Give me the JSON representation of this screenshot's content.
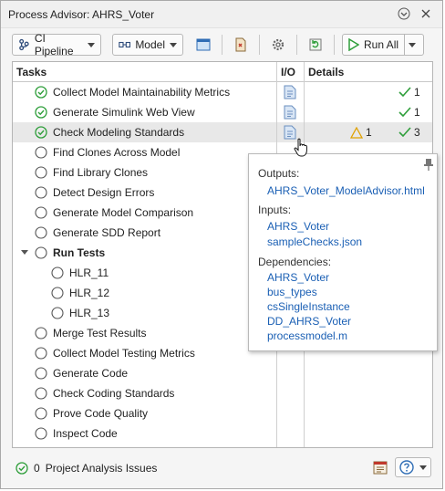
{
  "window": {
    "title": "Process Advisor: AHRS_Voter"
  },
  "toolbar": {
    "pipeline_label": "CI Pipeline",
    "model_label": "Model",
    "run_all_label": "Run All"
  },
  "table": {
    "headers": {
      "tasks": "Tasks",
      "io": "I/O",
      "details": "Details"
    },
    "rows": [
      {
        "label": "Collect Model Maintainability Metrics",
        "status": "done",
        "io": true,
        "pass": "1"
      },
      {
        "label": "Generate Simulink Web View",
        "status": "done",
        "io": true,
        "pass": "1"
      },
      {
        "label": "Check Modeling Standards",
        "status": "done",
        "io": true,
        "warn": "1",
        "pass": "3"
      },
      {
        "label": "Find Clones Across Model",
        "status": "pending"
      },
      {
        "label": "Find Library Clones",
        "status": "pending"
      },
      {
        "label": "Detect Design Errors",
        "status": "pending"
      },
      {
        "label": "Generate Model Comparison",
        "status": "pending"
      },
      {
        "label": "Generate SDD Report",
        "status": "pending"
      },
      {
        "label": "Run Tests",
        "status": "pending"
      },
      {
        "label": "HLR_11",
        "status": "pending"
      },
      {
        "label": "HLR_12",
        "status": "pending"
      },
      {
        "label": "HLR_13",
        "status": "pending"
      },
      {
        "label": "Merge Test Results",
        "status": "pending"
      },
      {
        "label": "Collect Model Testing Metrics",
        "status": "pending"
      },
      {
        "label": "Generate Code",
        "status": "pending"
      },
      {
        "label": "Check Coding Standards",
        "status": "pending"
      },
      {
        "label": "Prove Code Quality",
        "status": "pending"
      },
      {
        "label": "Inspect Code",
        "status": "pending"
      }
    ]
  },
  "tooltip": {
    "outputs_heading": "Outputs:",
    "outputs": [
      "AHRS_Voter_ModelAdvisor.html"
    ],
    "inputs_heading": "Inputs:",
    "inputs": [
      "AHRS_Voter",
      "sampleChecks.json"
    ],
    "dependencies_heading": "Dependencies:",
    "dependencies": [
      "AHRS_Voter",
      "bus_types",
      "csSingleInstance",
      "DD_AHRS_Voter",
      "processmodel.m"
    ]
  },
  "statusbar": {
    "issue_count": "0",
    "issue_label": "Project Analysis Issues"
  },
  "colors": {
    "pass": "#2e9e3a",
    "warn": "#e0a100",
    "link": "#1a5fb4",
    "selected_row": "#e8e8e8"
  },
  "icons": {
    "help": "help-icon",
    "report": "report-icon",
    "pin": "pin-icon",
    "git": "git-icon",
    "gear": "settings-icon",
    "layout": "layout-icon",
    "refresh": "refresh-icon"
  }
}
